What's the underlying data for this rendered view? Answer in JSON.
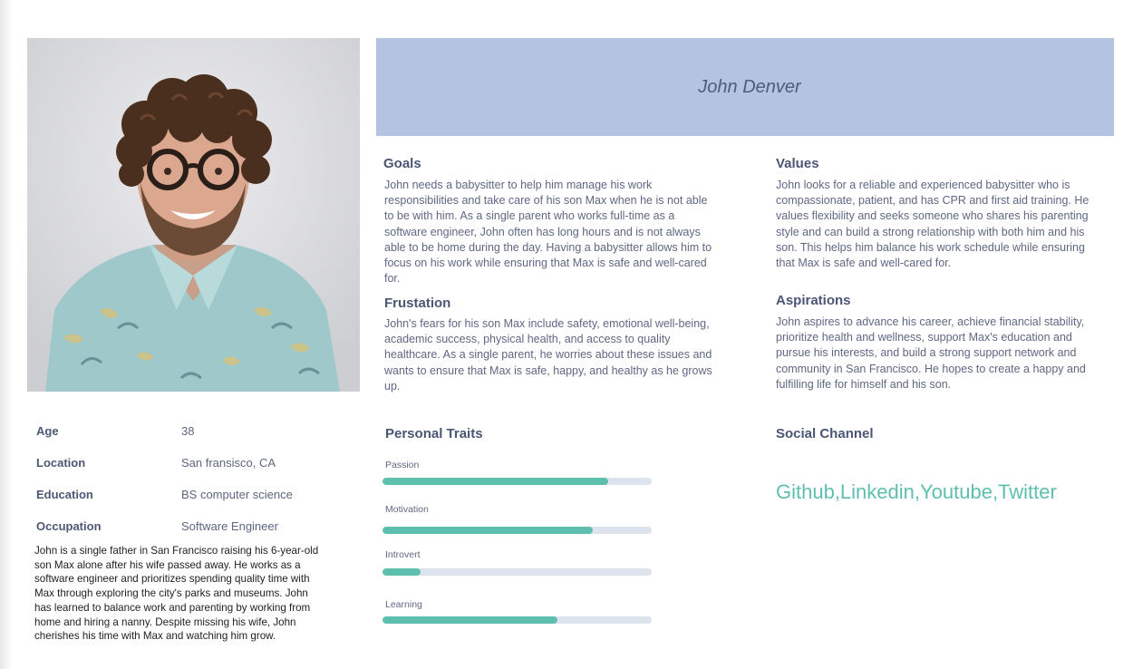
{
  "persona": {
    "name": "John Denver",
    "facts": [
      {
        "label": "Age",
        "value": "38"
      },
      {
        "label": "Location",
        "value": "San fransisco, CA"
      },
      {
        "label": "Education",
        "value": "BS computer science"
      },
      {
        "label": "Occupation",
        "value": "Software Engineer"
      }
    ],
    "bio": "John is a single father in San Francisco raising his 6-year-old son Max alone after his wife passed away. He works as a software engineer and prioritizes spending quality time with Max through exploring the city's parks and museums. John has learned to balance work and parenting by working from home and hiring a nanny. Despite missing his wife, John cherishes his time with Max and watching him grow."
  },
  "sections": {
    "goals": {
      "title": "Goals",
      "text": "John needs a babysitter to help him manage his work responsibilities and take care of his son Max when he is not able to be with him. As a single parent who works full-time as a software engineer, John often has long hours and is not always able to be home during the day. Having a babysitter allows him to focus on his work while ensuring that Max is safe and well-cared for."
    },
    "frustration": {
      "title": "Frustation",
      "text": "John's fears for his son Max include safety, emotional well-being, academic success, physical health, and access to quality healthcare. As a single parent, he worries about these issues and wants to ensure that Max is safe, happy, and healthy as he grows up."
    },
    "values": {
      "title": "Values",
      "text": "John looks for a reliable and experienced babysitter who is compassionate, patient, and has CPR and first aid training. He values flexibility and seeks someone who shares his parenting style and can build a strong relationship with both him and his son. This helps him balance his work schedule while ensuring that Max is safe and well-cared for."
    },
    "aspirations": {
      "title": "Aspirations",
      "text": "John aspires to advance his career, achieve financial stability, prioritize health and wellness, support Max's education and pursue his interests, and build a strong support network and community in San Francisco. He hopes to create a happy and fulfilling life for himself and his son."
    }
  },
  "traits": {
    "title": "Personal Traits",
    "items": [
      {
        "label": "Passion",
        "value": 0.84
      },
      {
        "label": "Motivation",
        "value": 0.78
      },
      {
        "label": "Introvert",
        "value": 0.14
      },
      {
        "label": "Learning",
        "value": 0.65
      }
    ]
  },
  "social": {
    "title": "Social Channel",
    "channels": "Github,Linkedin,Youtube,Twitter"
  },
  "colors": {
    "banner": "#b4c3e2",
    "accent": "#5fbfae",
    "track": "#dde4ee"
  }
}
